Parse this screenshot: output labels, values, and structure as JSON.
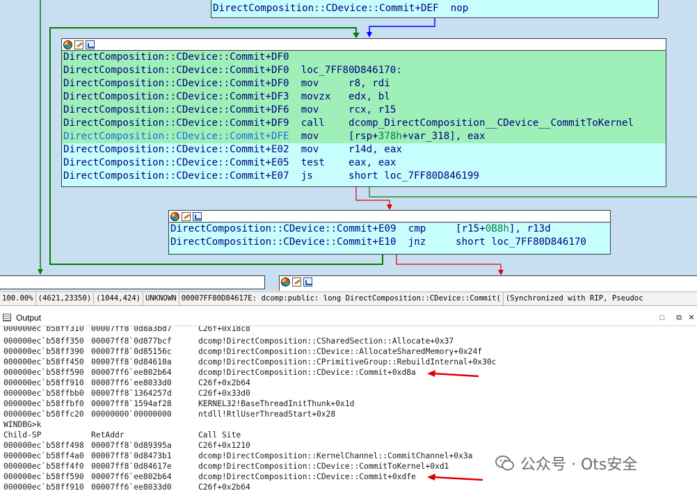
{
  "graph": {
    "top_node": {
      "lines": [
        {
          "addr": "DirectComposition::CDevice::Commit+DEF",
          "mnem": "nop",
          "ops": ""
        }
      ]
    },
    "node_main": {
      "lines": [
        {
          "addr": "DirectComposition::CDevice::Commit+DF0",
          "mnem": "",
          "ops": ""
        },
        {
          "addr": "DirectComposition::CDevice::Commit+DF0",
          "mnem": "loc_7FF80D846170:",
          "ops": ""
        },
        {
          "addr": "DirectComposition::CDevice::Commit+DF0",
          "mnem": "mov",
          "ops": "r8, rdi"
        },
        {
          "addr": "DirectComposition::CDevice::Commit+DF3",
          "mnem": "movzx",
          "ops": "edx, bl"
        },
        {
          "addr": "DirectComposition::CDevice::Commit+DF6",
          "mnem": "mov",
          "ops": "rcx, r15"
        },
        {
          "addr": "DirectComposition::CDevice::Commit+DF9",
          "mnem": "call",
          "ops": "dcomp_DirectComposition__CDevice__CommitToKernel"
        },
        {
          "addr": "DirectComposition::CDevice::Commit+DFE",
          "mnem": "mov",
          "ops_pre": "[rsp+",
          "ops_num": "378h",
          "ops_post": "+var_318], eax"
        },
        {
          "addr": "DirectComposition::CDevice::Commit+E02",
          "mnem": "mov",
          "ops": "r14d, eax"
        },
        {
          "addr": "DirectComposition::CDevice::Commit+E05",
          "mnem": "test",
          "ops": "eax, eax"
        },
        {
          "addr": "DirectComposition::CDevice::Commit+E07",
          "mnem": "js",
          "ops": "short loc_7FF80D846199"
        }
      ]
    },
    "node_cmp": {
      "lines": [
        {
          "addr": "DirectComposition::CDevice::Commit+E09",
          "mnem": "cmp",
          "ops_pre": "[r15+",
          "ops_num": "0B8h",
          "ops_post": "], r13d"
        },
        {
          "addr": "DirectComposition::CDevice::Commit+E10",
          "mnem": "jnz",
          "ops": "short loc_7FF80D846170"
        }
      ]
    }
  },
  "statusbar": {
    "zoom": "100.00%",
    "coords1": "(4621,23350)",
    "coords2": "(1044,424)",
    "segment": "UNKNOWN",
    "location": "00007FF80D84617E: dcomp:public: long DirectComposition::CDevice::Commit(",
    "sync": "(Synchronized with RIP, Pseudoc"
  },
  "output_panel": {
    "title": "Output",
    "lines": [
      {
        "sp": "000000ec`b58ff310",
        "ret": "00007ff8`0d8a3bd7",
        "site": "C26f+0x18c8"
      },
      {
        "sp": "000000ec`b58ff350",
        "ret": "00007ff8`0d877bcf",
        "site": "dcomp!DirectComposition::CSharedSection::Allocate+0x37"
      },
      {
        "sp": "000000ec`b58ff390",
        "ret": "00007ff8`0d85156c",
        "site": "dcomp!DirectComposition::CDevice::AllocateSharedMemory+0x24f"
      },
      {
        "sp": "000000ec`b58ff450",
        "ret": "00007ff8`0d84610a",
        "site": "dcomp!DirectComposition::CPrimitiveGroup::RebuildInternal+0x30c"
      },
      {
        "sp": "000000ec`b58ff590",
        "ret": "00007ff6`ee802b64",
        "site": "dcomp!DirectComposition::CDevice::Commit+0xd8a"
      },
      {
        "sp": "000000ec`b58ff910",
        "ret": "00007ff6`ee8033d0",
        "site": "C26f+0x2b64"
      },
      {
        "sp": "000000ec`b58ffbb0",
        "ret": "00007ff8`1364257d",
        "site": "C26f+0x33d0"
      },
      {
        "sp": "000000ec`b58ffbf0",
        "ret": "00007ff8`1594af28",
        "site": "KERNEL32!BaseThreadInitThunk+0x1d"
      },
      {
        "sp": "000000ec`b58ffc20",
        "ret": "00000000`00000000",
        "site": "ntdll!RtlUserThreadStart+0x28"
      },
      {
        "sp": "WINDBG>k",
        "ret": "",
        "site": ""
      },
      {
        "sp": "Child-SP",
        "ret": "RetAddr",
        "site": "Call Site"
      },
      {
        "sp": "000000ec`b58ff498",
        "ret": "00007ff8`0d89395a",
        "site": "C26f+0x1210"
      },
      {
        "sp": "000000ec`b58ff4a0",
        "ret": "00007ff8`0d8473b1",
        "site": "dcomp!DirectComposition::KernelChannel::CommitChannel+0x3a"
      },
      {
        "sp": "000000ec`b58ff4f0",
        "ret": "00007ff8`0d84617e",
        "site": "dcomp!DirectComposition::CDevice::CommitToKernel+0xd1"
      },
      {
        "sp": "000000ec`b58ff590",
        "ret": "00007ff6`ee802b64",
        "site": "dcomp!DirectComposition::CDevice::Commit+0xdfe"
      },
      {
        "sp": "000000ec`b58ff910",
        "ret": "00007ff6`ee8033d0",
        "site": "C26f+0x2b64"
      }
    ]
  },
  "watermark": {
    "text": "公众号 · Ots安全"
  },
  "colors": {
    "graph_bg": "#c8dff2",
    "node_bg": "#c6fefe",
    "node_highlight": "#9ff0b8",
    "edge_green": "#008000",
    "edge_blue": "#0000ff",
    "edge_red": "#e00000",
    "annotation_red": "#e00000"
  }
}
